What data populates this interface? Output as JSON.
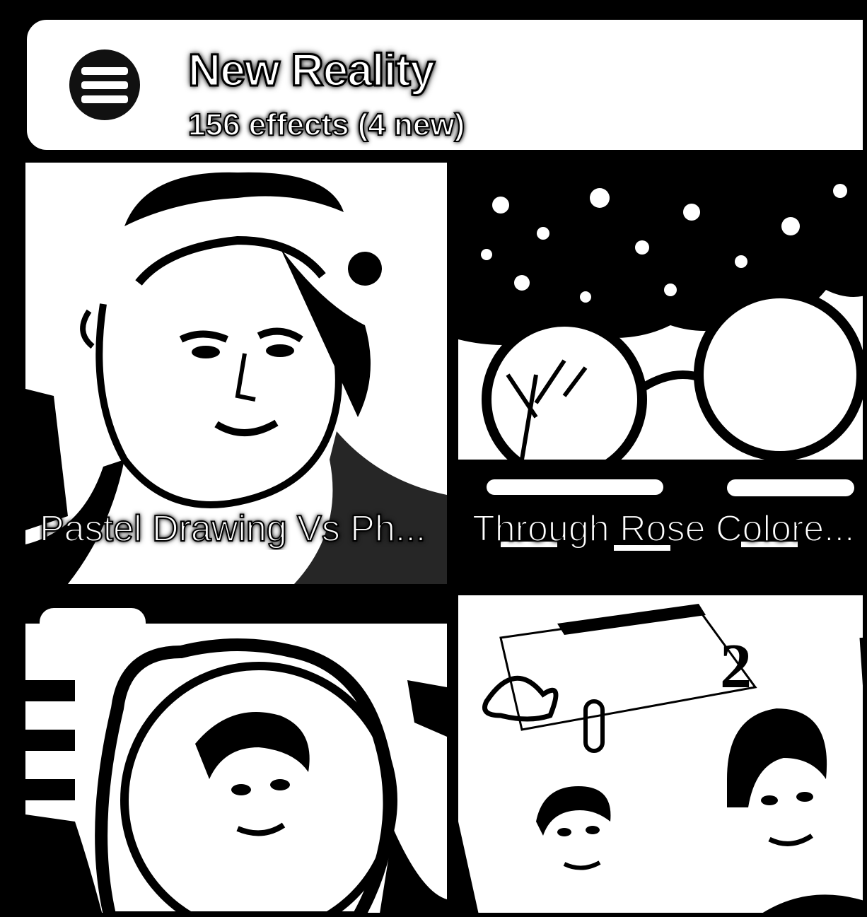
{
  "header": {
    "title": "New Reality",
    "subtitle": "156 effects (4 new)",
    "menu_icon": "hamburger-menu-icon"
  },
  "effects": [
    {
      "label": "Pastel Drawing Vs Ph..."
    },
    {
      "label": "Through Rose Colore..."
    },
    {
      "label": ""
    },
    {
      "label": "",
      "badge": "2"
    }
  ],
  "colors": {
    "ink": "#000000",
    "paper": "#ffffff"
  }
}
